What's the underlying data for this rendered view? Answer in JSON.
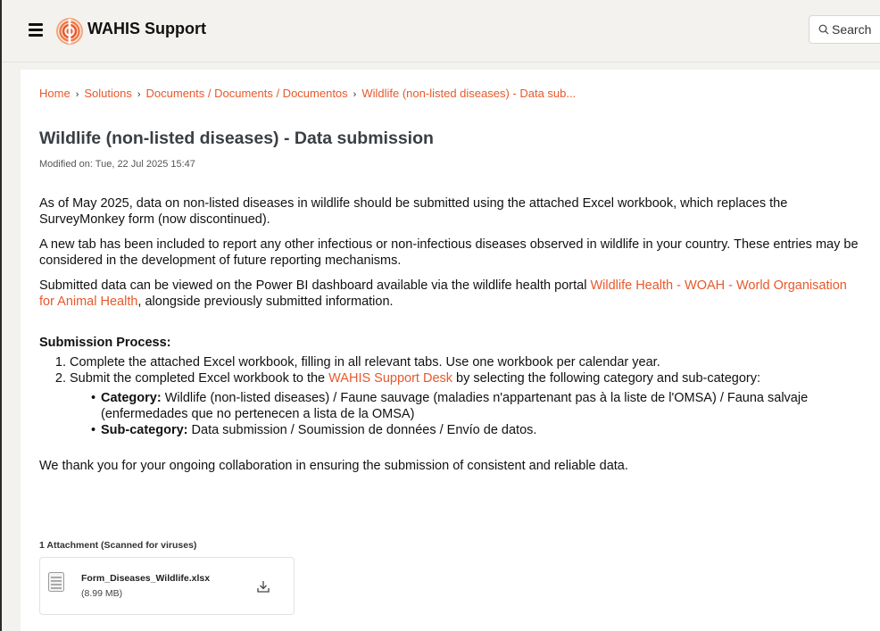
{
  "header": {
    "brand": "WAHIS Support",
    "search_label": "Search",
    "accent": "#e8582a"
  },
  "breadcrumb": [
    "Home",
    "Solutions",
    "Documents / Documents / Documentos",
    "Wildlife (non-listed diseases) - Data sub..."
  ],
  "article": {
    "title": "Wildlife (non-listed diseases) - Data submission",
    "modified": "Modified on: Tue, 22 Jul 2025 15:47",
    "p1": "As of May 2025, data on non-listed diseases in wildlife should be submitted using the attached Excel workbook, which replaces the SurveyMonkey form (now discontinued).",
    "p2": "A new tab has been included to report any other infectious or non-infectious diseases observed in wildlife in your country. These entries may be considered in the development of future reporting mechanisms.",
    "p3_before": "Submitted data can be viewed on the Power BI dashboard available via the wildlife health portal ",
    "p3_link": "Wildlife Health - WOAH - World Organisation for Animal Health",
    "p3_after": ", alongside previously submitted information.",
    "process_title": "Submission Process:",
    "step1": "Complete the attached Excel workbook, filling in all relevant tabs. Use one workbook per calendar year.",
    "step2_before": "Submit the completed Excel workbook to the ",
    "step2_link": "WAHIS Support Desk",
    "step2_after": " by selecting the following category and sub-category:",
    "category_label": "Category:",
    "category_value": " Wildlife (non-listed diseases) / Faune sauvage (maladies n'appartenant pas à la liste de l'OMSA) / Fauna salvaje (enfermedades que no pertenecen a lista de la OMSA)",
    "subcategory_label": "Sub-category:",
    "subcategory_value": " Data submission / Soumission de données / Envío de datos.",
    "thanks": "We thank you for your ongoing collaboration in ensuring the submission of consistent and reliable data."
  },
  "attachments": {
    "title": "1 Attachment (Scanned for viruses)",
    "file_name": "Form_Diseases_Wildlife.xlsx",
    "file_size": "(8.99 MB)"
  }
}
